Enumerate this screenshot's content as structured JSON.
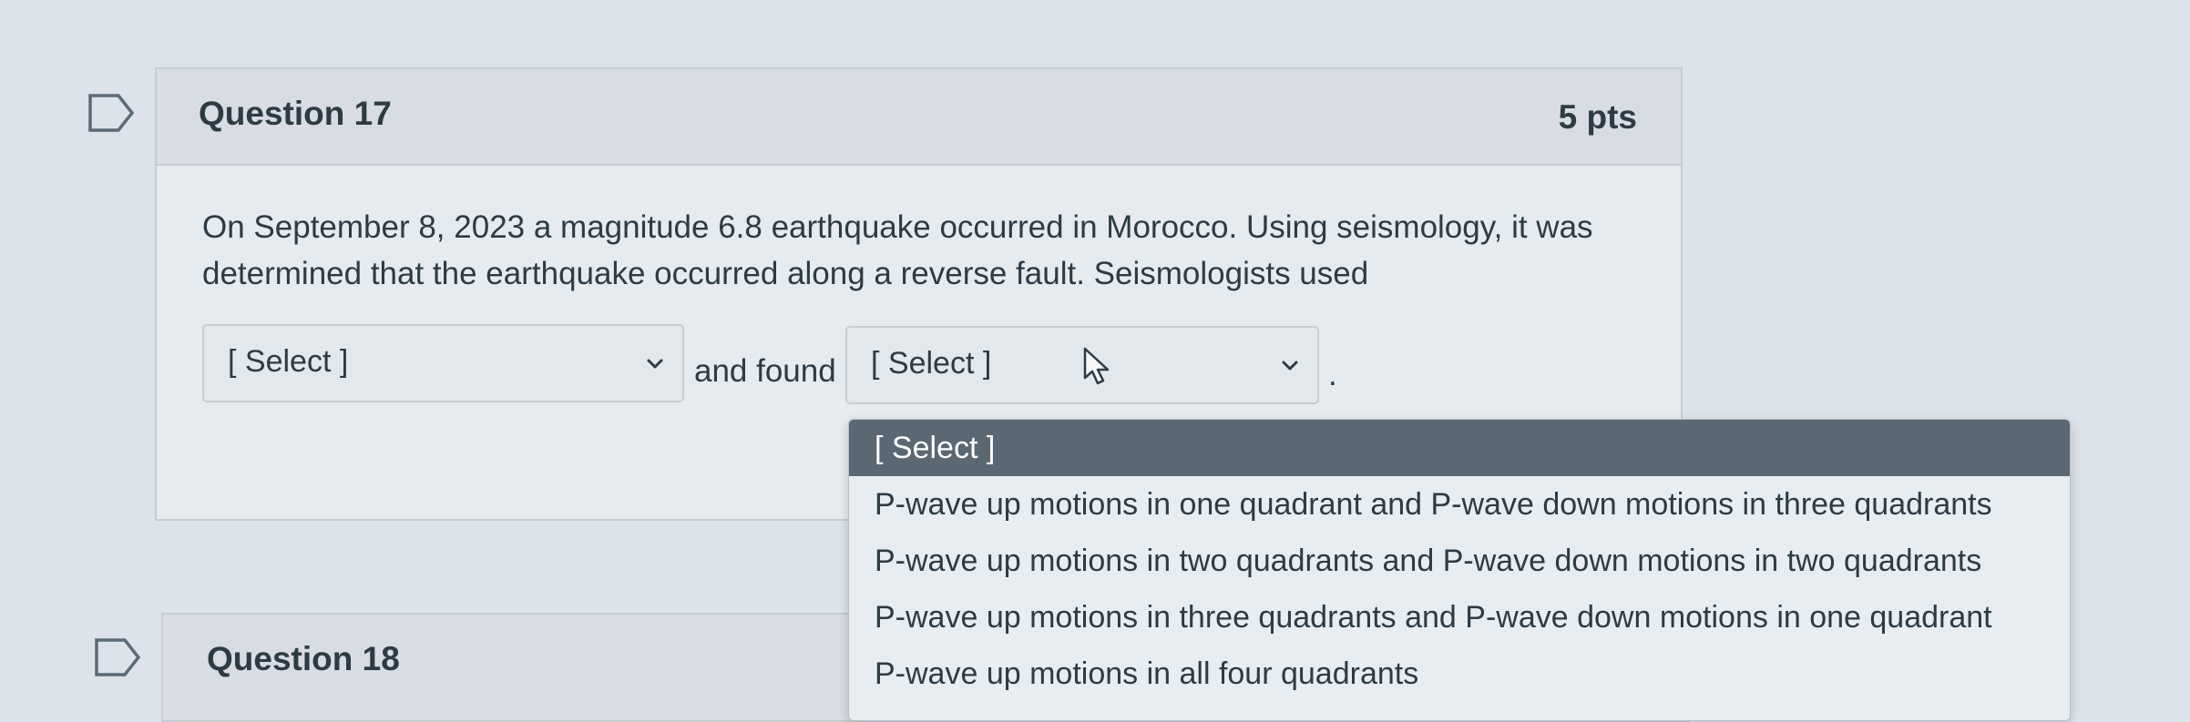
{
  "questions": [
    {
      "title": "Question 17",
      "points": "5 pts",
      "text": "On September 8, 2023 a magnitude 6.8 earthquake occurred in Morocco.  Using seismology, it was determined that the earthquake occurred along a reverse fault.  Seismologists used",
      "connector": "and found",
      "end_punctuation": ".",
      "select1_value": "[ Select ]",
      "select2_value": "[ Select ]"
    },
    {
      "title": "Question 18"
    }
  ],
  "dropdown": {
    "options": [
      "[ Select ]",
      "P-wave up motions in one quadrant and P-wave down motions in three quadrants",
      "P-wave up motions in two quadrants and P-wave down motions in two quadrants",
      "P-wave up motions in three quadrants and P-wave down motions in one quadrant",
      "P-wave up motions in all four quadrants"
    ],
    "highlighted_index": 0
  },
  "icons": {
    "flag": "bookmark-flag-icon",
    "chevron": "chevron-down-icon",
    "cursor": "mouse-pointer-icon"
  },
  "colors": {
    "page_background": "#dde3ea",
    "header_background": "#d7dde3",
    "highlight_background": "#5a6873",
    "text": "#2d3b45"
  }
}
